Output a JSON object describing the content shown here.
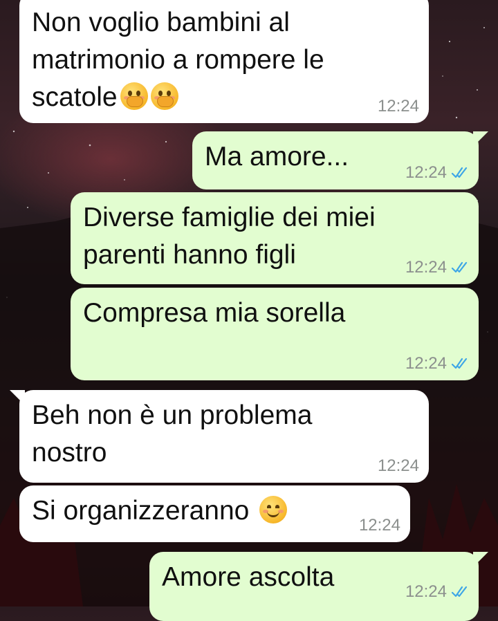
{
  "messages": [
    {
      "text": "Non voglio bambini al\nmatrimonio a rompere le\nscatole",
      "emoji": [
        "face-with-hand-over-mouth-emoji",
        "face-with-hand-over-mouth-emoji"
      ],
      "time": "12:24",
      "direction": "incoming"
    },
    {
      "text": "Ma amore...",
      "time": "12:24",
      "direction": "outgoing",
      "status": "read-double-check"
    },
    {
      "text": "Diverse famiglie dei miei\nparenti hanno figli",
      "time": "12:24",
      "direction": "outgoing",
      "status": "read-double-check"
    },
    {
      "text": "Compresa mia sorella",
      "time": "12:24",
      "direction": "outgoing",
      "status": "read-double-check"
    },
    {
      "text": "Beh non è un problema\nnostro",
      "time": "12:24",
      "direction": "incoming"
    },
    {
      "text": "Si organizzeranno",
      "emoji": [
        "smiling-face-emoji"
      ],
      "time": "12:24",
      "direction": "incoming"
    },
    {
      "text": "Amore ascolta",
      "time": "12:24",
      "direction": "outgoing",
      "status": "read-double-check"
    }
  ],
  "colors": {
    "incoming_bubble": "#ffffff",
    "outgoing_bubble": "#e2fdd0",
    "read_ticks": "#3ea6e6",
    "timestamp": "#8b8f8d"
  }
}
